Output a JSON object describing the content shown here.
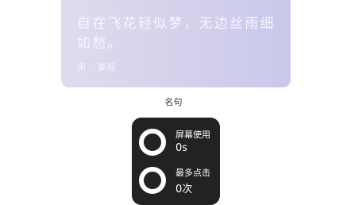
{
  "quote": {
    "text": "自在飞花轻似梦，无边丝雨细如愁。",
    "author": "宋 · 秦观"
  },
  "section": {
    "label": "名句"
  },
  "stats": {
    "screen_time": {
      "label": "屏幕使用",
      "value": "0s",
      "icon": "ring-icon"
    },
    "max_clicks": {
      "label": "最多点击",
      "value": "0次",
      "icon": "ring-icon"
    }
  },
  "colors": {
    "card_gradient_start": "#e1dbee",
    "card_gradient_end": "#c9c8ea",
    "panel_background": "#222222"
  }
}
